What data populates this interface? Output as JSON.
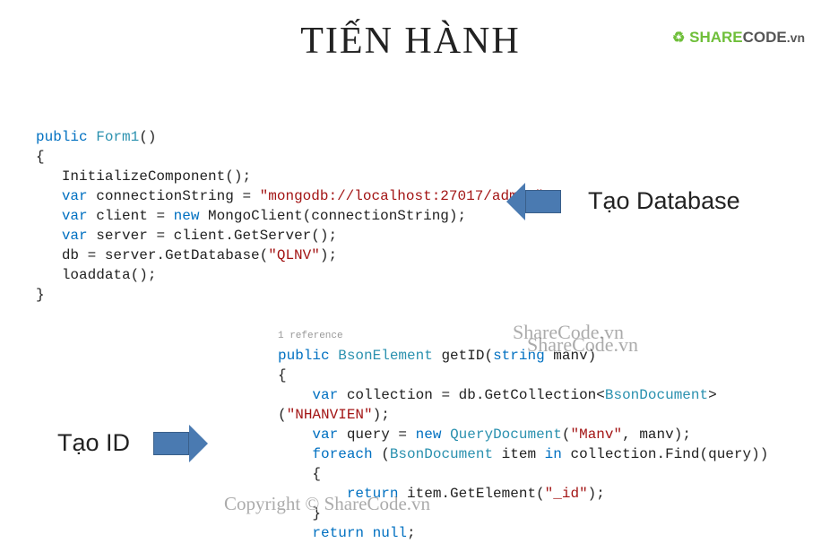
{
  "logo": {
    "brand1": "SHARE",
    "brand2": "CODE",
    "suffix": ".vn"
  },
  "title": "TIẾN HÀNH",
  "annotations": {
    "right": "Tạo Database",
    "left": "Tạo ID"
  },
  "code1": {
    "l1": {
      "kw": "public",
      "tp": "Form1",
      "paren": "()"
    },
    "l2": "{",
    "l3": "InitializeComponent();",
    "l4": {
      "kw": "var",
      "id": " connectionString = ",
      "str": "\"mongodb://localhost:27017/admin\"",
      "end": ";"
    },
    "l5": {
      "kw1": "var",
      "p1": " client = ",
      "kw2": "new",
      "p2": " MongoClient(connectionString);"
    },
    "l6": {
      "kw": "var",
      "p": " server = client.GetServer();"
    },
    "l7": {
      "p1": "db = server.GetDatabase(",
      "str": "\"QLNV\"",
      "p2": ");"
    },
    "l8": "loaddata();",
    "l9": "}"
  },
  "code2": {
    "ref": "1 reference",
    "l1": {
      "kw": "public",
      "sp": " ",
      "tp": "BsonElement",
      "id": " getID(",
      "kw2": "string",
      "id2": " manv)"
    },
    "l2": "{",
    "l3": {
      "kw": "var",
      "p1": " collection = db.GetCollection<",
      "tp": "BsonDocument",
      "p2": ">(",
      "str": "\"NHANVIEN\"",
      "p3": ");"
    },
    "l4": {
      "kw1": "var",
      "p1": " query = ",
      "kw2": "new",
      "sp": " ",
      "tp": "QueryDocument",
      "p2": "(",
      "str": "\"Manv\"",
      "p3": ", manv);"
    },
    "l5": {
      "kw1": "foreach",
      "p1": " (",
      "tp": "BsonDocument",
      "p2": " item ",
      "kw2": "in",
      "p3": " collection.Find(query))"
    },
    "l6": "{",
    "l7": {
      "kw": "return",
      "p1": " item.GetElement(",
      "str": "\"_id\"",
      "p2": ");"
    },
    "l8": "}",
    "l9": {
      "kw": "return",
      "sp": " ",
      "kw2": "null",
      "p": ";"
    }
  },
  "watermark": {
    "w1": "ShareCode.vn",
    "w2": "ShareCode.vn",
    "w3": "Copyright © ShareCode.vn"
  }
}
